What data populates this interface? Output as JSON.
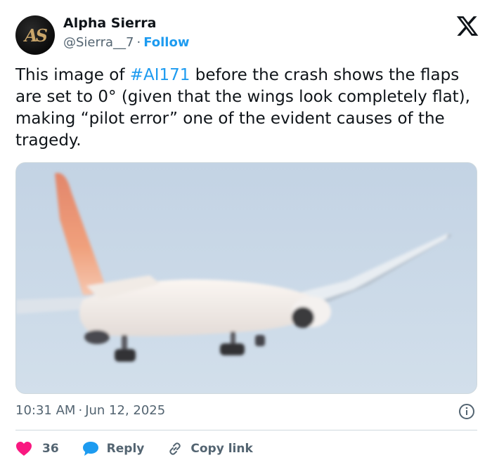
{
  "author": {
    "display_name": "Alpha Sierra",
    "handle": "@Sierra__7",
    "separator": "·",
    "follow_label": "Follow",
    "avatar_letters": "AS"
  },
  "tweet": {
    "text_before": "This image of ",
    "hashtag": "#AI171",
    "text_after": " before the crash shows the flaps are set to 0° (given that the wings look completely flat), making “pilot error” one of the evident causes of the tragedy."
  },
  "meta": {
    "time": "10:31 AM",
    "separator": "·",
    "date": "Jun 12, 2025"
  },
  "actions": {
    "likes": "36",
    "reply_label": "Reply",
    "copy_link_label": "Copy link"
  },
  "icons": {
    "platform": "x-logo-icon",
    "info": "info-icon",
    "like": "heart-icon",
    "reply": "speech-bubble-icon",
    "copy": "link-icon"
  },
  "colors": {
    "accent": "#1d9bf0",
    "like": "#f91880",
    "text": "#0f1419",
    "muted": "#536471"
  }
}
